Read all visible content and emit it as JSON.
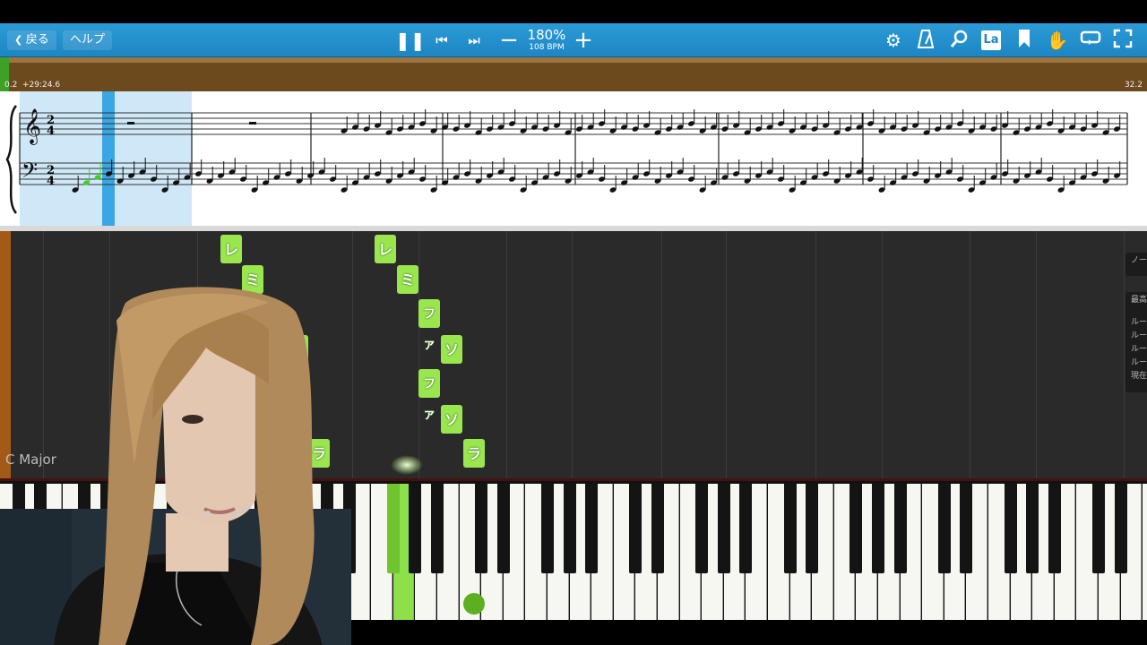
{
  "toolbar": {
    "back_label": "戻る",
    "help_label": "ヘルプ",
    "zoom": "180%",
    "bpm": "108 BPM",
    "la_label": "La"
  },
  "progress": {
    "start": "0.2",
    "elapsed": "+29:24.6",
    "end": "32.2",
    "fraction": 0.008
  },
  "sheet": {
    "time_signature_top": "2",
    "time_signature_bottom": "4"
  },
  "roll": {
    "key_name": "C Major",
    "notes_col1": [
      "レ",
      "ミ",
      "ソ",
      "ラ"
    ],
    "notes_col2": [
      "レ",
      "ミ",
      "ファ",
      "ソ",
      "ファ",
      "ソ",
      "ラ"
    ]
  },
  "side_panel": {
    "items": [
      "ノー",
      "最高",
      "ルー",
      "ルー",
      "ルー",
      "ルー",
      "現在"
    ]
  },
  "colors": {
    "toolbar": "#1d86c4",
    "note_green": "#9ae64e",
    "progress_brown": "#6c4a1e"
  }
}
